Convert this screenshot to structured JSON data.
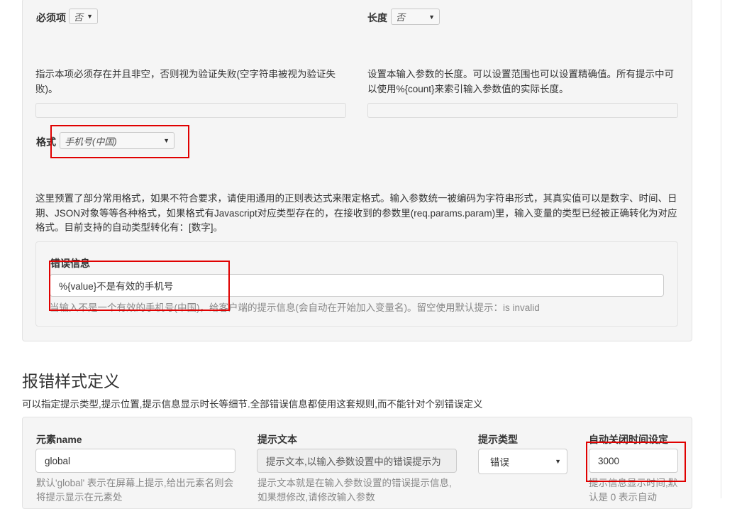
{
  "required": {
    "label": "必须项",
    "value": "否",
    "help": "指示本项必须存在并且非空，否则视为验证失败(空字符串被视为验证失败)。"
  },
  "length": {
    "label": "长度",
    "value": "否",
    "help": "设置本输入参数的长度。可以设置范围也可以设置精确值。所有提示中可以使用%{count}来索引输入参数值的实际长度。"
  },
  "format": {
    "label": "格式",
    "value": "手机号(中国)",
    "help": "这里预置了部分常用格式，如果不符合要求，请使用通用的正则表达式来限定格式。输入参数统一被编码为字符串形式，其真实值可以是数字、时间、日期、JSON对象等等各种格式，如果格式有Javascript对应类型存在的，在接收到的参数里(req.params.param)里，输入变量的类型已经被正确转化为对应格式。目前支持的自动类型转化有：[数字]。"
  },
  "error_message": {
    "label": "错误信息",
    "value": "%{value}不是有效的手机号",
    "help": "当输入不是一个有效的手机号(中国)，给客户端的提示信息(会自动在开始加入变量名)。留空使用默认提示：is invalid"
  },
  "error_style": {
    "title": "报错样式定义",
    "description": "可以指定提示类型,提示位置,提示信息显示时长等细节.全部错误信息都使用这套规则,而不能针对个别错误定义",
    "element_name": {
      "label": "元素name",
      "value": "global",
      "help": "默认'global' 表示在屏幕上提示,给出元素名则会将提示显示在元素处"
    },
    "hint_text": {
      "label": "提示文本",
      "value": "提示文本,以输入参数设置中的错误提示为",
      "help": "提示文本就是在输入参数设置的错误提示信息,如果想修改,请修改输入参数"
    },
    "hint_type": {
      "label": "提示类型",
      "value": "错误"
    },
    "auto_close": {
      "label": "自动关闭时间设定",
      "value": "3000",
      "help": "提示信息显示时间,默认是 0 表示自动"
    }
  }
}
